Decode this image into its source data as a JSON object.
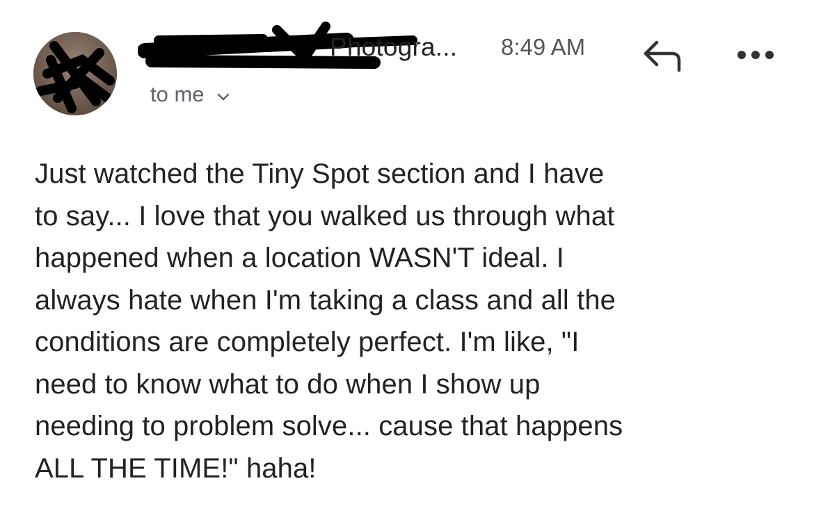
{
  "sender": {
    "name_visible": "Photogra...",
    "name_redacted": true
  },
  "time": "8:49 AM",
  "recipient": {
    "label": "to me"
  },
  "icons": {
    "avatar": "avatar-photo-redacted",
    "reply": "reply-arrow-icon",
    "more": "more-horizontal-icon",
    "chevron": "chevron-down-icon"
  },
  "colors": {
    "text": "#222222",
    "secondary": "#5f6368",
    "redaction": "#000000"
  },
  "message": {
    "body": "Just watched the Tiny Spot section and I have\nto say... I love that you walked us through what\nhappened when a location WASN'T ideal. I\nalways hate when I'm taking a class and all the\nconditions are completely perfect. I'm like, \"I\nneed to know what to do when I show up\nneeding to problem solve... cause that happens\nALL THE TIME!\" haha!"
  }
}
